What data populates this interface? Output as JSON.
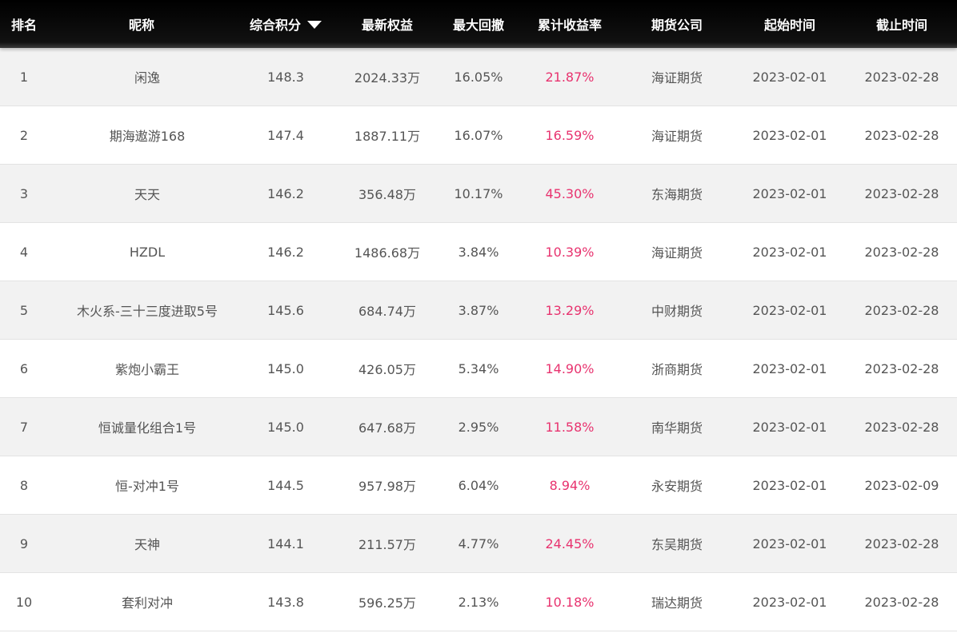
{
  "colors": {
    "header_bg": "#000000",
    "return_red": "#e8336f",
    "row_alt": "#f2f2f2"
  },
  "header": {
    "rank": "排名",
    "name": "昵称",
    "score": "综合积分",
    "score_sort_icon": "sort-down-icon",
    "equity": "最新权益",
    "drawdown": "最大回撤",
    "return": "累计收益率",
    "company": "期货公司",
    "start": "起始时间",
    "end": "截止时间"
  },
  "rows": [
    {
      "rank": "1",
      "name": "闲逸",
      "score": "148.3",
      "equity": "2024.33万",
      "drawdown": "16.05%",
      "return": "21.87%",
      "company": "海证期货",
      "start": "2023-02-01",
      "end": "2023-02-28"
    },
    {
      "rank": "2",
      "name": "期海遨游168",
      "score": "147.4",
      "equity": "1887.11万",
      "drawdown": "16.07%",
      "return": "16.59%",
      "company": "海证期货",
      "start": "2023-02-01",
      "end": "2023-02-28"
    },
    {
      "rank": "3",
      "name": "天天",
      "score": "146.2",
      "equity": "356.48万",
      "drawdown": "10.17%",
      "return": "45.30%",
      "company": "东海期货",
      "start": "2023-02-01",
      "end": "2023-02-28"
    },
    {
      "rank": "4",
      "name": "HZDL",
      "score": "146.2",
      "equity": "1486.68万",
      "drawdown": "3.84%",
      "return": "10.39%",
      "company": "海证期货",
      "start": "2023-02-01",
      "end": "2023-02-28"
    },
    {
      "rank": "5",
      "name": "木火系-三十三度进取5号",
      "score": "145.6",
      "equity": "684.74万",
      "drawdown": "3.87%",
      "return": "13.29%",
      "company": "中财期货",
      "start": "2023-02-01",
      "end": "2023-02-28"
    },
    {
      "rank": "6",
      "name": "紫炮小霸王",
      "score": "145.0",
      "equity": "426.05万",
      "drawdown": "5.34%",
      "return": "14.90%",
      "company": "浙商期货",
      "start": "2023-02-01",
      "end": "2023-02-28"
    },
    {
      "rank": "7",
      "name": "恒诚量化组合1号",
      "score": "145.0",
      "equity": "647.68万",
      "drawdown": "2.95%",
      "return": "11.58%",
      "company": "南华期货",
      "start": "2023-02-01",
      "end": "2023-02-28"
    },
    {
      "rank": "8",
      "name": "恒-对冲1号",
      "score": "144.5",
      "equity": "957.98万",
      "drawdown": "6.04%",
      "return": "8.94%",
      "company": "永安期货",
      "start": "2023-02-01",
      "end": "2023-02-09"
    },
    {
      "rank": "9",
      "name": "天神",
      "score": "144.1",
      "equity": "211.57万",
      "drawdown": "4.77%",
      "return": "24.45%",
      "company": "东吴期货",
      "start": "2023-02-01",
      "end": "2023-02-28"
    },
    {
      "rank": "10",
      "name": "套利对冲",
      "score": "143.8",
      "equity": "596.25万",
      "drawdown": "2.13%",
      "return": "10.18%",
      "company": "瑞达期货",
      "start": "2023-02-01",
      "end": "2023-02-28"
    }
  ]
}
